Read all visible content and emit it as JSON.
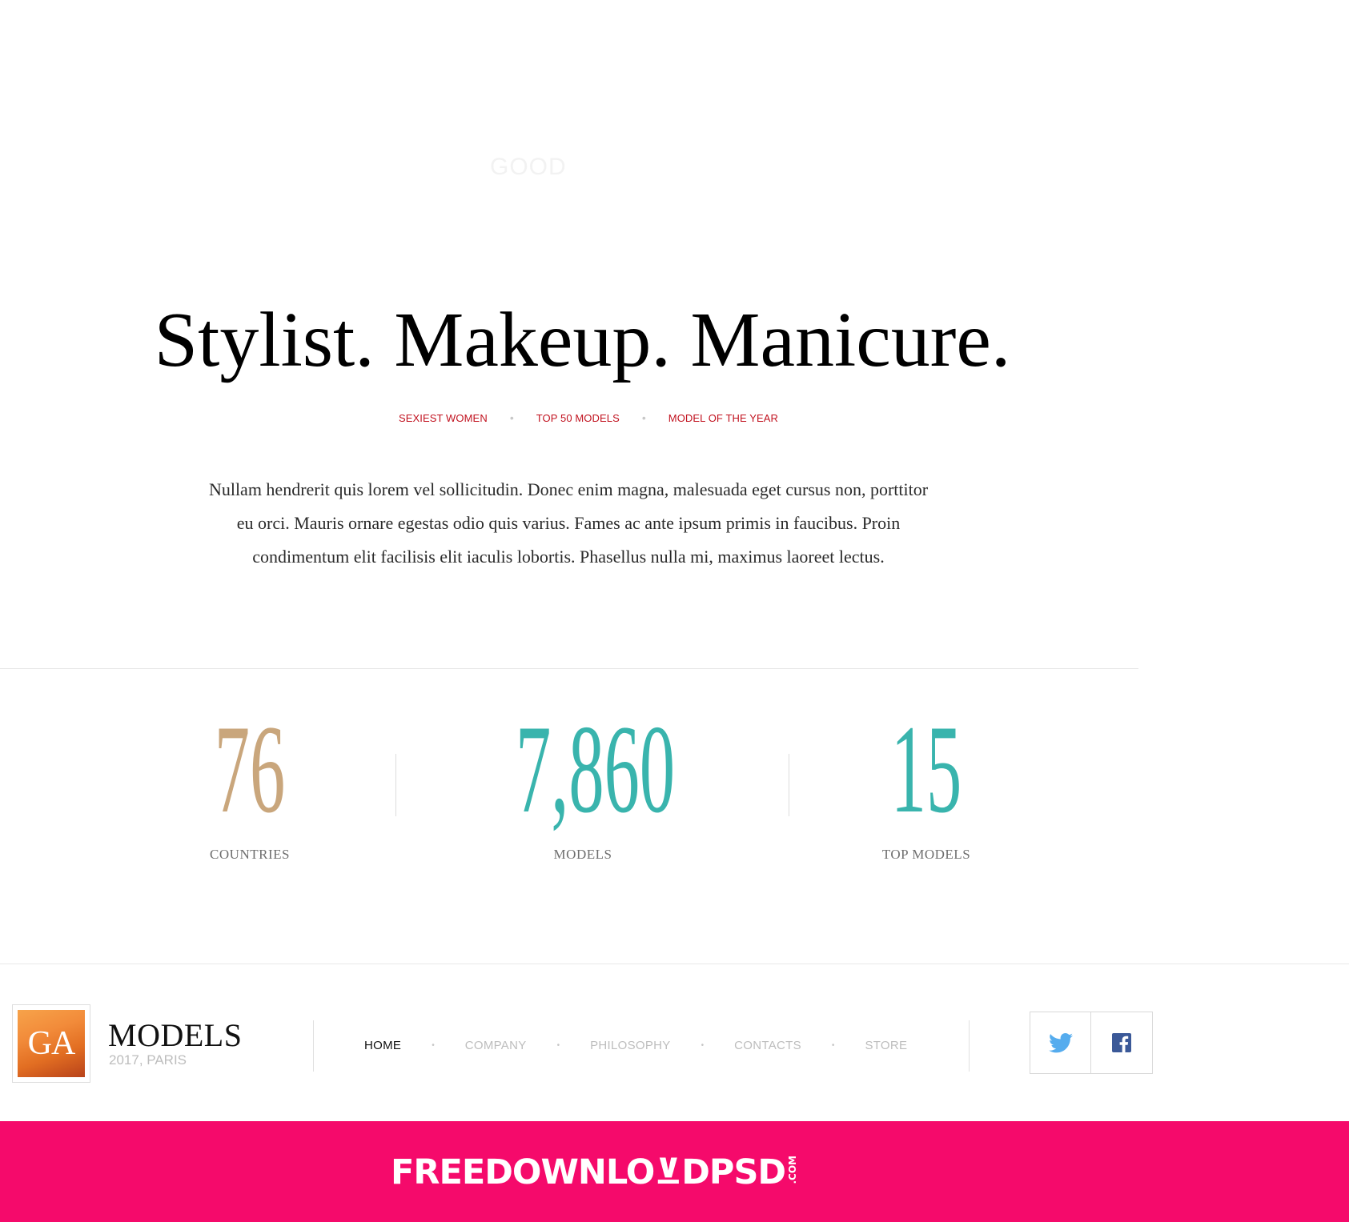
{
  "watermark_faint": "GOOD",
  "hero": {
    "title": "Stylist. Makeup. Manicure.",
    "tags": [
      "SEXIEST WOMEN",
      "TOP 50 MODELS",
      "MODEL OF THE YEAR"
    ],
    "intro": "Nullam hendrerit quis lorem vel sollicitudin. Donec enim magna, malesuada eget cursus non, porttitor eu orci. Mauris ornare egestas odio quis varius. Fames ac ante ipsum primis in faucibus. Proin condimentum elit facilisis elit iaculis lobortis. Phasellus nulla mi, maximus laoreet lectus."
  },
  "stats": [
    {
      "value": "76",
      "label": "COUNTRIES",
      "color": "#c9a67c"
    },
    {
      "value": "7,860",
      "label": "MODELS",
      "color": "#39b4ad"
    },
    {
      "value": "15",
      "label": "TOP MODELS",
      "color": "#39b4ad"
    }
  ],
  "footer": {
    "logo_text": "GA",
    "brand_name": "MODELS",
    "brand_sub": "2017, PARIS",
    "nav": [
      "HOME",
      "COMPANY",
      "PHILOSOPHY",
      "CONTACTS",
      "STORE"
    ],
    "nav_active": "HOME",
    "social": [
      {
        "icon": "twitter-icon",
        "color": "#55acee"
      },
      {
        "icon": "facebook-icon",
        "color": "#3b5998"
      }
    ]
  },
  "banner": {
    "text": "FREEDOWNLO⊻DPSD",
    "suffix": ".COM",
    "color": "#f50a6b"
  }
}
